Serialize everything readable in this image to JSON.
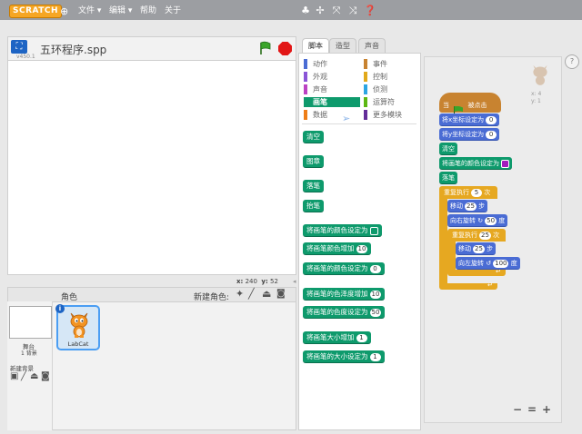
{
  "app": {
    "logo": "SCRATCH",
    "menus": [
      "文件 ▾",
      "编辑 ▾",
      "帮助",
      "关于"
    ]
  },
  "stage": {
    "project_name": "五环程序.spp",
    "version": "v450.1",
    "coords": {
      "x_label": "x:",
      "x": "240",
      "y_label": "y:",
      "y": "52"
    }
  },
  "sprites": {
    "header": "角色",
    "new_sprite_label": "新建角色:",
    "stage_label": "舞台",
    "backdrop_count": "1 背景",
    "new_backdrop": "新建背景",
    "sprite_name": "LabCat"
  },
  "tabs": [
    "脚本",
    "造型",
    "声音"
  ],
  "categories": {
    "left": [
      {
        "label": "动作",
        "color": "#4a6cd4"
      },
      {
        "label": "外观",
        "color": "#8a55d7"
      },
      {
        "label": "声音",
        "color": "#bb42c3"
      },
      {
        "label": "画笔",
        "color": "#0e9a6c"
      },
      {
        "label": "数据",
        "color": "#ee7d16"
      }
    ],
    "right": [
      {
        "label": "事件",
        "color": "#c88330"
      },
      {
        "label": "控制",
        "color": "#e1a91a"
      },
      {
        "label": "侦测",
        "color": "#2ca5e2"
      },
      {
        "label": "运算符",
        "color": "#5cb712"
      },
      {
        "label": "更多模块",
        "color": "#632d99"
      }
    ],
    "selected": "画笔"
  },
  "palette_blocks": [
    {
      "text": "清空"
    },
    {
      "text": "图章"
    },
    {
      "text": "落笔"
    },
    {
      "text": "抬笔"
    },
    {
      "text": "将画笔的颜色设定为",
      "swatch": "#0e9a6c"
    },
    {
      "text": "将画笔颜色增加",
      "arg": "10"
    },
    {
      "text": "将画笔的颜色设定为",
      "arg": "0"
    },
    {
      "text": "将画笔的色泽度增加",
      "arg": "10"
    },
    {
      "text": "将画笔的色度设定为",
      "arg": "50"
    },
    {
      "text": "将画笔大小增加",
      "arg": "1"
    },
    {
      "text": "将画笔的大小设定为",
      "arg": "1"
    }
  ],
  "script": {
    "hat_when": "当",
    "hat_clicked": "被点击",
    "set_x": "将x坐标设定为",
    "set_x_val": "0",
    "set_y": "将y坐标设定为",
    "set_y_val": "0",
    "clear": "清空",
    "set_color": "将画笔的颜色设定为",
    "pen_down": "落笔",
    "repeat_outer": "重复执行",
    "repeat_outer_val": "5",
    "times": "次",
    "move": "移动",
    "move_val1": "25",
    "steps": "步",
    "turn_right": "向右旋转",
    "turn_right_val": "50",
    "degrees": "度",
    "repeat_inner": "重复执行",
    "repeat_inner_val": "25",
    "move_val2": "25",
    "turn_left": "向左旋转",
    "turn_left_val": "100"
  },
  "sprite_info": {
    "x": "x: 4",
    "y": "y: 1"
  },
  "zoom_controls": [
    "−",
    "=",
    "+"
  ]
}
